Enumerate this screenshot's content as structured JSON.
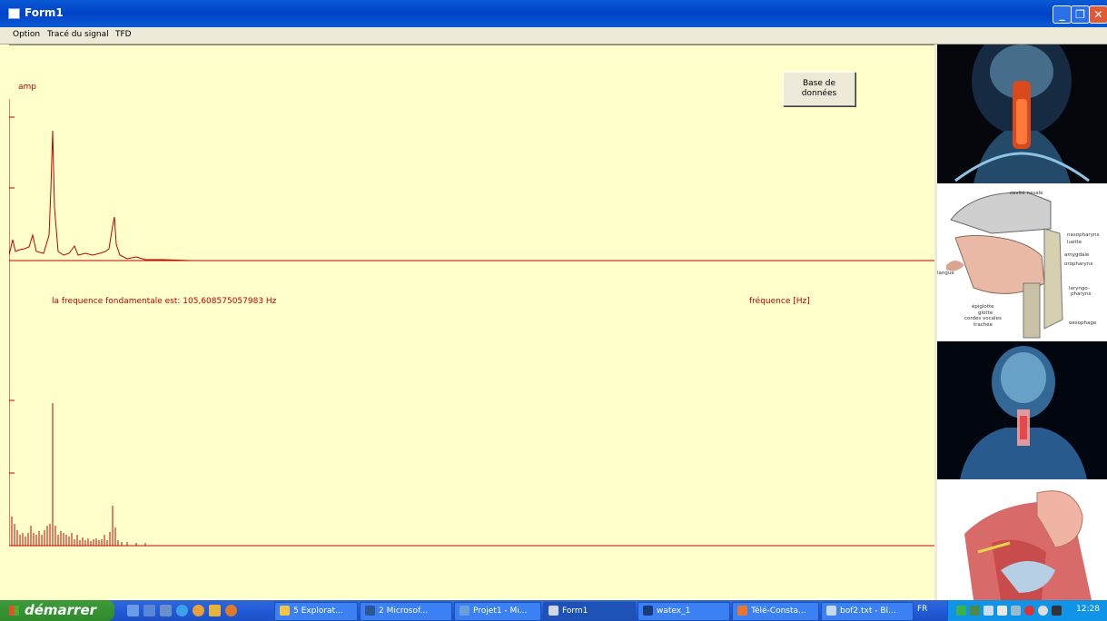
{
  "window": {
    "title": "Form1"
  },
  "menu": [
    {
      "label": "Option"
    },
    {
      "label": "Tracé du signal"
    },
    {
      "label": "TFD"
    }
  ],
  "plot": {
    "amp_label": "amp",
    "db_button": "Base de\ndonnées",
    "fundamental": "la frequence fondamentale est:  105,608575057983 Hz",
    "freq_label": "fréquence [Hz]",
    "color": "#c00000"
  },
  "images": [
    {
      "name": "throat-xray-image"
    },
    {
      "name": "vocal-tract-diagram",
      "labels": [
        "cavité nasale",
        "nasopharynx",
        "luette",
        "amygdale",
        "oropharynx",
        "langue",
        "laryngo-",
        "pharynx",
        "épiglotte",
        "glotte",
        "cordes vocales",
        "trachée",
        "oesophage"
      ]
    },
    {
      "name": "body-xray-image"
    },
    {
      "name": "ear-neck-anatomy-image"
    }
  ],
  "taskbar": {
    "start": "démarrer",
    "tasks": [
      {
        "label": "5 Explorat...",
        "icon_color": "#f5c542"
      },
      {
        "label": "2 Microsof...",
        "icon_color": "#2b5797"
      },
      {
        "label": "Projet1 - Mi...",
        "icon_color": "#6aa0d8"
      },
      {
        "label": "Form1",
        "icon_color": "#d0d8e8",
        "active": true
      },
      {
        "label": "watex_1",
        "icon_color": "#1b3a7a"
      },
      {
        "label": "Télé-Consta...",
        "icon_color": "#e8772e"
      },
      {
        "label": "bof2.txt - Bl...",
        "icon_color": "#c8d8ee"
      }
    ],
    "lang": "FR",
    "clock": "12:28"
  }
}
